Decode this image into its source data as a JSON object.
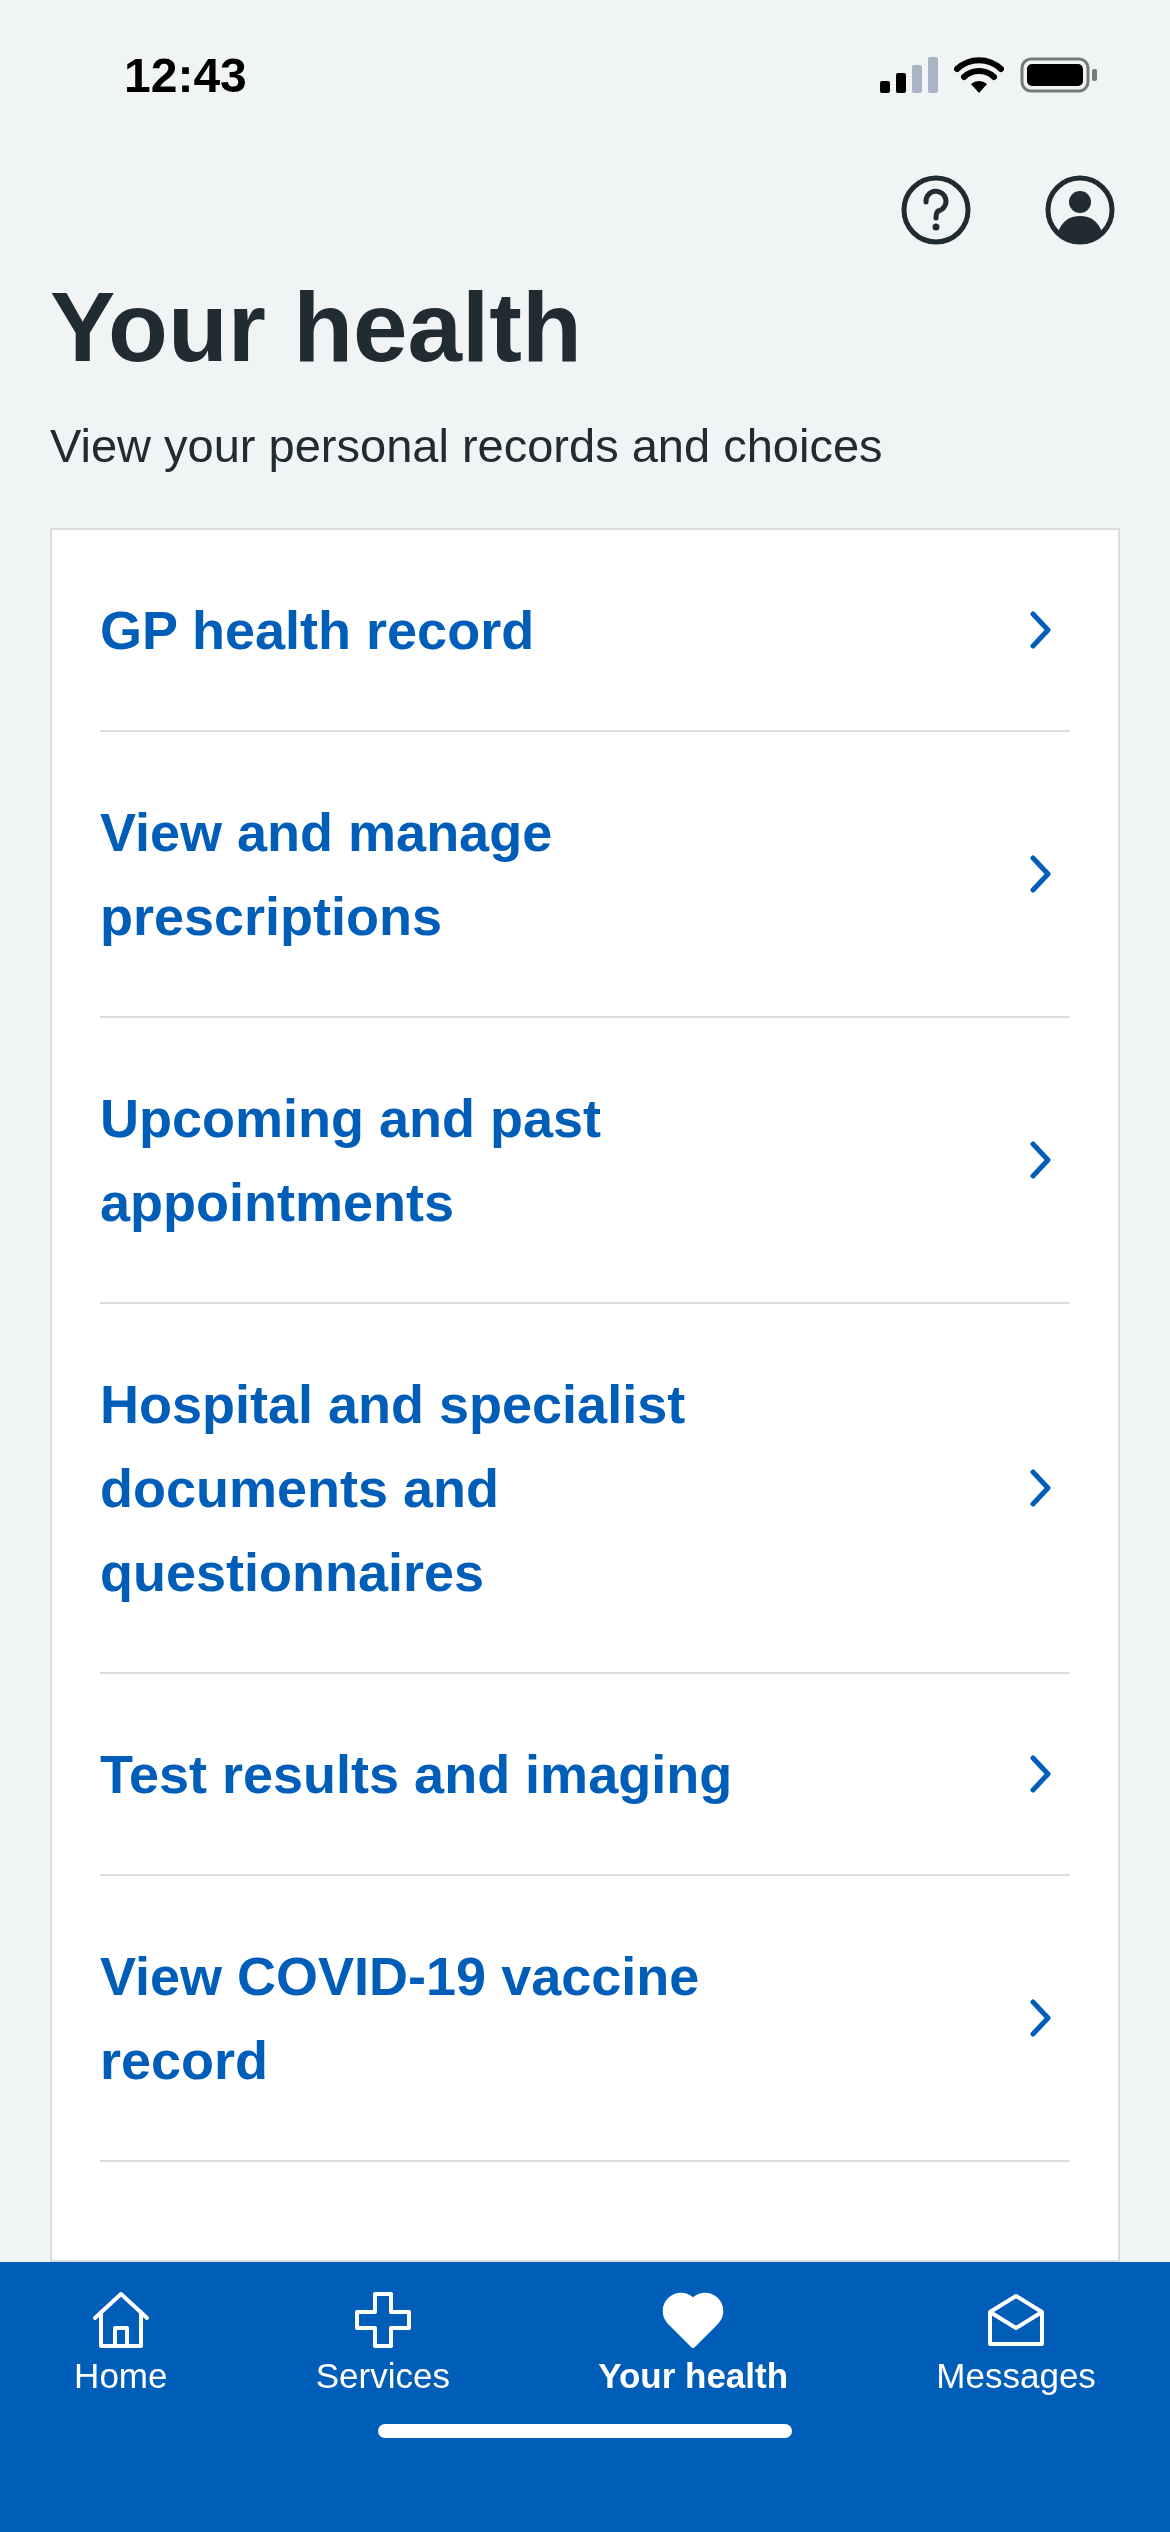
{
  "status_bar": {
    "time": "12:43"
  },
  "header": {
    "title": "Your health",
    "subtitle": "View your personal records and choices"
  },
  "menu_items": [
    {
      "label": "GP health record"
    },
    {
      "label": "View and manage prescriptions"
    },
    {
      "label": "Upcoming and past appointments"
    },
    {
      "label": "Hospital and specialist documents and questionnaires"
    },
    {
      "label": "Test results and imaging"
    },
    {
      "label": "View COVID-19 vaccine record"
    }
  ],
  "tab_bar": [
    {
      "kind": "home",
      "label": "Home",
      "selected": false
    },
    {
      "kind": "services",
      "label": "Services",
      "selected": false
    },
    {
      "kind": "health",
      "label": "Your health",
      "selected": true
    },
    {
      "kind": "messages",
      "label": "Messages",
      "selected": false
    }
  ]
}
